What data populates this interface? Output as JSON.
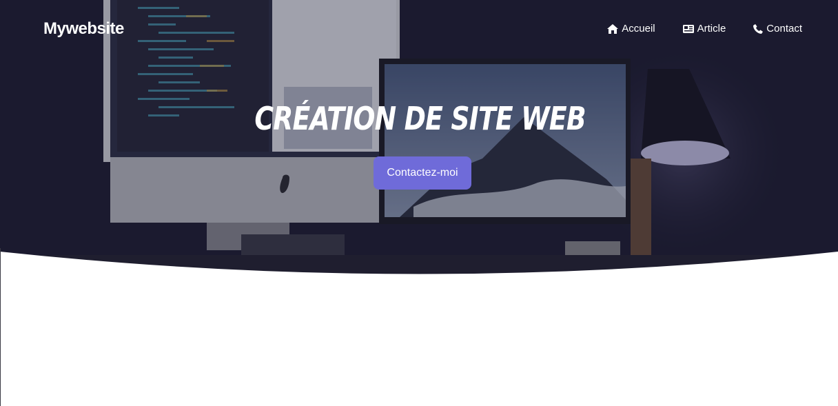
{
  "header": {
    "brand": "Mywebsite",
    "nav": [
      {
        "label": "Accueil",
        "icon": "home-icon"
      },
      {
        "label": "Article",
        "icon": "newspaper-icon"
      },
      {
        "label": "Contact",
        "icon": "phone-icon"
      }
    ]
  },
  "hero": {
    "title": "CRÉATION DE SITE WEB",
    "cta_label": "Contactez-moi",
    "background": "photo-of-desk-with-computer-monitors",
    "overlay_color": "#1b1a2e",
    "cta_color": "#6f6bd9"
  }
}
